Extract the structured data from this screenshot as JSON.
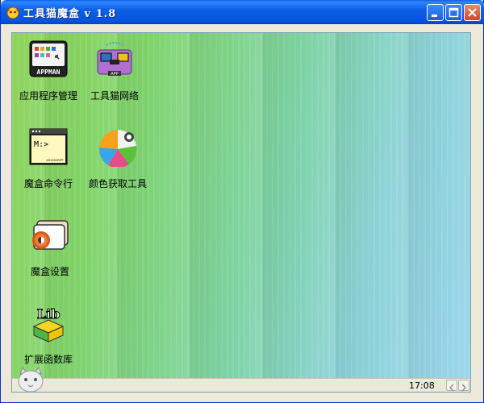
{
  "window": {
    "title": "工具猫魔盒  v 1.8",
    "minimize_label": "Minimize",
    "maximize_label": "Maximize",
    "close_label": "Close"
  },
  "desktop": {
    "icons": [
      {
        "label": "应用程序管理",
        "icon": "appman-icon",
        "icon_text": "APPMAN"
      },
      {
        "label": "工具猫网络",
        "icon": "network-icon",
        "icon_text": "APP"
      },
      {
        "label": "魔盒命令行",
        "icon": "command-line-icon",
        "icon_text": "M:>",
        "icon_subtext": "JOHOSCRIPT"
      },
      {
        "label": "颜色获取工具",
        "icon": "color-picker-icon"
      },
      {
        "label": "魔盒设置",
        "icon": "settings-icon"
      },
      {
        "label": "扩展函数库",
        "icon": "library-icon",
        "icon_text": "Lib"
      }
    ]
  },
  "statusbar": {
    "time": "17:08"
  }
}
